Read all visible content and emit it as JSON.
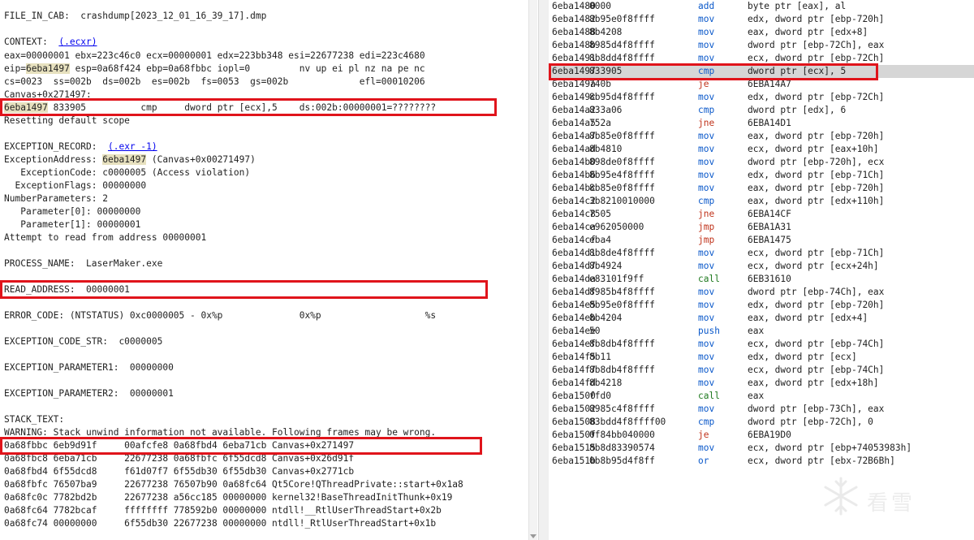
{
  "left": {
    "file_label": "FILE_IN_CAB:  crashdump[2023_12_01_16_39_17].dmp",
    "context_label": "CONTEXT:  ",
    "context_link": "(.ecxr)",
    "regs1": "eax=00000001 ebx=223c46c0 ecx=00000001 edx=223bb348 esi=22677238 edi=223c4680",
    "regs2_pre": "eip=",
    "regs2_hl": "6eba1497",
    "regs2_post": " esp=0a68f424 ebp=0a68fbbc iopl=0         nv up ei pl nz na pe nc",
    "regs3": "cs=0023  ss=002b  ds=002b  es=002b  fs=0053  gs=002b             efl=00010206",
    "canvas_line": "Canvas+0x271497:",
    "instr_hl": "6eba1497",
    "instr_rest": " 833905          cmp     dword ptr [ecx],5    ds:002b:00000001=????????",
    "reset_line": "Resetting default scope",
    "exrec_label": "EXCEPTION_RECORD:  ",
    "exrec_link": "(.exr -1)",
    "exaddr_pre": "ExceptionAddress: ",
    "exaddr_hl": "6eba1497",
    "exaddr_post": " (Canvas+0x00271497)",
    "excode": "   ExceptionCode: c0000005 (Access violation)",
    "exflags": "  ExceptionFlags: 00000000",
    "numparams": "NumberParameters: 2",
    "param0": "   Parameter[0]: 00000000",
    "param1": "   Parameter[1]: 00000001",
    "attempt": "Attempt to read from address 00000001",
    "process_name": "PROCESS_NAME:  LaserMaker.exe",
    "read_address": "READ_ADDRESS:  00000001",
    "error_code": "ERROR_CODE: (NTSTATUS) 0xc0000005 - 0x%p              0x%p                   %s",
    "exc_code_str": "EXCEPTION_CODE_STR:  c0000005",
    "exc_param1": "EXCEPTION_PARAMETER1:  00000000",
    "exc_param2": "EXCEPTION_PARAMETER2:  00000001",
    "stack_text": "STACK_TEXT:",
    "warning": "WARNING: Stack unwind information not available. Following frames may be wrong.",
    "stack": [
      "0a68fbbc 6eb9d91f     00afcfe8 0a68fbd4 6eba71cb Canvas+0x271497",
      "0a68fbc8 6eba71cb     22677238 0a68fbfc 6f55dcd8 Canvas+0x26d91f",
      "0a68fbd4 6f55dcd8     f61d07f7 6f55db30 6f55db30 Canvas+0x2771cb",
      "0a68fbfc 76507ba9     22677238 76507b90 0a68fc64 Qt5Core!QThreadPrivate::start+0x1a8",
      "0a68fc0c 7782bd2b     22677238 a56cc185 00000000 kernel32!BaseThreadInitThunk+0x19",
      "0a68fc64 7782bcaf     ffffffff 778592b0 00000000 ntdll!__RtlUserThreadStart+0x2b",
      "0a68fc74 00000000     6f55db30 22677238 00000000 ntdll!_RtlUserThreadStart+0x1b"
    ]
  },
  "disasm": [
    {
      "addr": "6eba1480",
      "bytes": "0000",
      "mn": "add",
      "op": "byte ptr [eax], al",
      "cls": "mn-mov"
    },
    {
      "addr": "6eba1482",
      "bytes": "8b95e0f8ffff",
      "mn": "mov",
      "op": "edx, dword ptr [ebp-720h]",
      "cls": "mn-mov"
    },
    {
      "addr": "6eba1488",
      "bytes": "8b4208",
      "mn": "mov",
      "op": "eax, dword ptr [edx+8]",
      "cls": "mn-mov"
    },
    {
      "addr": "6eba148b",
      "bytes": "8985d4f8ffff",
      "mn": "mov",
      "op": "dword ptr [ebp-72Ch], eax",
      "cls": "mn-mov"
    },
    {
      "addr": "6eba1491",
      "bytes": "8b8dd4f8ffff",
      "mn": "mov",
      "op": "ecx, dword ptr [ebp-72Ch]",
      "cls": "mn-mov"
    },
    {
      "addr": "6eba1497",
      "bytes": "833905",
      "mn": "cmp",
      "op": "dword ptr [ecx], 5",
      "cls": "mn-blue",
      "sel": true
    },
    {
      "addr": "6eba149a",
      "bytes": "740b",
      "mn": "je",
      "op": "6EBA14A7",
      "cls": "mn-jmp"
    },
    {
      "addr": "6eba149c",
      "bytes": "8b95d4f8ffff",
      "mn": "mov",
      "op": "edx, dword ptr [ebp-72Ch]",
      "cls": "mn-mov"
    },
    {
      "addr": "6eba14a2",
      "bytes": "833a06",
      "mn": "cmp",
      "op": "dword ptr [edx], 6",
      "cls": "mn-blue"
    },
    {
      "addr": "6eba14a5",
      "bytes": "752a",
      "mn": "jne",
      "op": "6EBA14D1",
      "cls": "mn-jmp"
    },
    {
      "addr": "6eba14a7",
      "bytes": "8b85e0f8ffff",
      "mn": "mov",
      "op": "eax, dword ptr [ebp-720h]",
      "cls": "mn-mov"
    },
    {
      "addr": "6eba14ad",
      "bytes": "8b4810",
      "mn": "mov",
      "op": "ecx, dword ptr [eax+10h]",
      "cls": "mn-mov"
    },
    {
      "addr": "6eba14b0",
      "bytes": "898de0f8ffff",
      "mn": "mov",
      "op": "dword ptr [ebp-720h], ecx",
      "cls": "mn-mov"
    },
    {
      "addr": "6eba14b6",
      "bytes": "8b95e4f8ffff",
      "mn": "mov",
      "op": "edx, dword ptr [ebp-71Ch]",
      "cls": "mn-mov"
    },
    {
      "addr": "6eba14bc",
      "bytes": "8b85e0f8ffff",
      "mn": "mov",
      "op": "eax, dword ptr [ebp-720h]",
      "cls": "mn-mov"
    },
    {
      "addr": "6eba14c2",
      "bytes": "3b8210010000",
      "mn": "cmp",
      "op": "eax, dword ptr [edx+110h]",
      "cls": "mn-blue"
    },
    {
      "addr": "6eba14c8",
      "bytes": "7505",
      "mn": "jne",
      "op": "6EBA14CF",
      "cls": "mn-jmp"
    },
    {
      "addr": "6eba14ca",
      "bytes": "e962050000",
      "mn": "jmp",
      "op": "6EBA1A31",
      "cls": "mn-jmp"
    },
    {
      "addr": "6eba14cf",
      "bytes": "eba4",
      "mn": "jmp",
      "op": "6EBA1475",
      "cls": "mn-jmp"
    },
    {
      "addr": "6eba14d1",
      "bytes": "8b8de4f8ffff",
      "mn": "mov",
      "op": "ecx, dword ptr [ebp-71Ch]",
      "cls": "mn-mov"
    },
    {
      "addr": "6eba14d7",
      "bytes": "8b4924",
      "mn": "mov",
      "op": "ecx, dword ptr [ecx+24h]",
      "cls": "mn-mov"
    },
    {
      "addr": "6eba14da",
      "bytes": "e83101f9ff",
      "mn": "call",
      "op": "6EB31610",
      "cls": "mn-call"
    },
    {
      "addr": "6eba14df",
      "bytes": "8985b4f8ffff",
      "mn": "mov",
      "op": "dword ptr [ebp-74Ch], eax",
      "cls": "mn-mov"
    },
    {
      "addr": "6eba14e5",
      "bytes": "8b95e0f8ffff",
      "mn": "mov",
      "op": "edx, dword ptr [ebp-720h]",
      "cls": "mn-mov"
    },
    {
      "addr": "6eba14eb",
      "bytes": "8b4204",
      "mn": "mov",
      "op": "eax, dword ptr [edx+4]",
      "cls": "mn-mov"
    },
    {
      "addr": "6eba14ee",
      "bytes": "50",
      "mn": "push",
      "op": "eax",
      "cls": "mn-push"
    },
    {
      "addr": "6eba14ef",
      "bytes": "8b8db4f8ffff",
      "mn": "mov",
      "op": "ecx, dword ptr [ebp-74Ch]",
      "cls": "mn-mov"
    },
    {
      "addr": "6eba14f5",
      "bytes": "8b11",
      "mn": "mov",
      "op": "edx, dword ptr [ecx]",
      "cls": "mn-mov"
    },
    {
      "addr": "6eba14f7",
      "bytes": "8b8db4f8ffff",
      "mn": "mov",
      "op": "ecx, dword ptr [ebp-74Ch]",
      "cls": "mn-mov"
    },
    {
      "addr": "6eba14fd",
      "bytes": "8b4218",
      "mn": "mov",
      "op": "eax, dword ptr [edx+18h]",
      "cls": "mn-mov"
    },
    {
      "addr": "6eba1500",
      "bytes": "ffd0",
      "mn": "call",
      "op": "eax",
      "cls": "mn-call"
    },
    {
      "addr": "6eba1502",
      "bytes": "8985c4f8ffff",
      "mn": "mov",
      "op": "dword ptr [ebp-73Ch], eax",
      "cls": "mn-mov"
    },
    {
      "addr": "6eba1508",
      "bytes": "83bdd4f8ffff00",
      "mn": "cmp",
      "op": "dword ptr [ebp-72Ch], 0",
      "cls": "mn-blue"
    },
    {
      "addr": "6eba150f",
      "bytes": "0f84bb040000",
      "mn": "je",
      "op": "6EBA19D0",
      "cls": "mn-jmp"
    },
    {
      "addr": "6eba1515",
      "bytes": "8b8d83390574",
      "mn": "mov",
      "op": "ecx, dword ptr [ebp+74053983h]",
      "cls": "mn-mov"
    },
    {
      "addr": "6eba151b",
      "bytes": "0b8b95d4f8ff",
      "mn": "or",
      "op": "ecx, dword ptr [ebx-72B6Bh]",
      "cls": "mn-mov"
    }
  ],
  "watermark": "看雪"
}
